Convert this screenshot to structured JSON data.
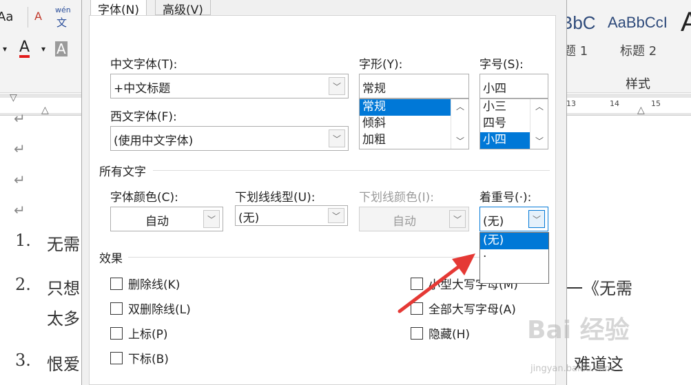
{
  "ribbon": {
    "font_aa": "Aa",
    "pinyin_top": "wén",
    "pinyin_bottom": "文",
    "font_color_icon": "A",
    "highlight_icon": "A",
    "style_sample_1": "BbC",
    "style_sample_2": "AaBbCcI",
    "style_name_1": "题 1",
    "style_name_2": "标题 2",
    "styles_group_label": "样式"
  },
  "ruler": {
    "ticks": [
      "13",
      "14",
      "15"
    ]
  },
  "document": {
    "lines": [
      {
        "num": "1.",
        "text": "无需"
      },
      {
        "num": "2.",
        "text": "只想"
      },
      {
        "num": "",
        "text": "太多"
      },
      {
        "num": "3.",
        "text": "恨爱"
      }
    ],
    "right_text_1": "一《无需",
    "right_text_2": "难道这",
    "para_mark": "↵"
  },
  "dialog": {
    "tabs": [
      {
        "label": "字体(N)"
      },
      {
        "label": "高级(V)"
      }
    ],
    "chinese_font": {
      "label": "中文字体(T):",
      "value": "+中文标题"
    },
    "western_font": {
      "label": "西文字体(F):",
      "value": "(使用中文字体)"
    },
    "font_style": {
      "label": "字形(Y):",
      "value": "常规",
      "options": [
        "常规",
        "倾斜",
        "加粗"
      ],
      "selected": "常规"
    },
    "font_size": {
      "label": "字号(S):",
      "value": "小四",
      "options": [
        "小三",
        "四号",
        "小四"
      ],
      "selected": "小四"
    },
    "all_text_section": "所有文字",
    "font_color": {
      "label": "字体颜色(C):",
      "value": "自动"
    },
    "underline_type": {
      "label": "下划线线型(U):",
      "value": "(无)"
    },
    "underline_color": {
      "label": "下划线颜色(I):",
      "value": "自动"
    },
    "emphasis_mark": {
      "label": "着重号(·):",
      "value": "(无)",
      "options": [
        "(无)",
        "·"
      ],
      "selected": "(无)"
    },
    "effects_section": "效果",
    "effects_left": [
      "删除线(K)",
      "双删除线(L)",
      "上标(P)",
      "下标(B)"
    ],
    "effects_right": [
      "小型大写字母(M)",
      "全部大写字母(A)",
      "隐藏(H)"
    ]
  },
  "watermark": {
    "text": "Bai 经验",
    "sub": "jingyan.baidu.com"
  },
  "colors": {
    "accent": "#0078d7",
    "arrow": "#e53935"
  }
}
